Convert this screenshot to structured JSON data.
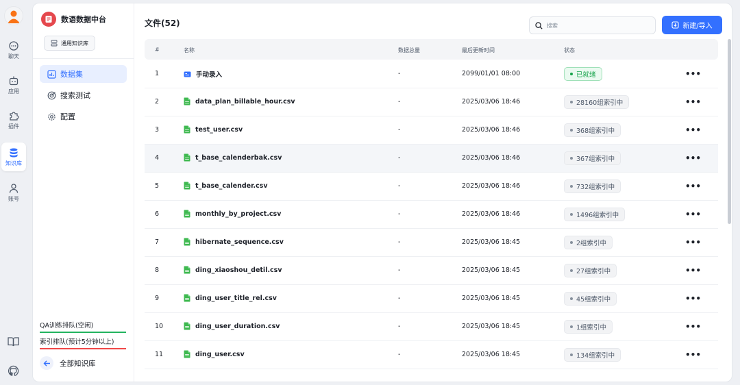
{
  "rail": {
    "items": [
      {
        "label": "聊天",
        "icon": "chat-icon"
      },
      {
        "label": "应用",
        "icon": "robot-icon"
      },
      {
        "label": "插件",
        "icon": "puzzle-icon"
      },
      {
        "label": "知识库",
        "icon": "database-icon",
        "active": true
      },
      {
        "label": "账号",
        "icon": "user-icon"
      }
    ],
    "bottom": [
      "book-icon",
      "github-icon"
    ]
  },
  "sidebar": {
    "brand": "数语数据中台",
    "kb_type": "通用知识库",
    "nav": [
      {
        "label": "数据集",
        "icon": "chart-icon",
        "active": true
      },
      {
        "label": "搜索测试",
        "icon": "target-icon"
      },
      {
        "label": "配置",
        "icon": "gear-icon"
      }
    ],
    "queue_qa": "QA训练排队(空闲)",
    "queue_index": "索引排队(预计5分钟以上)",
    "back_label": "全部知识库"
  },
  "main": {
    "title": "文件(52)",
    "search_placeholder": "搜索",
    "new_button": "新建/导入",
    "columns": {
      "index": "#",
      "name": "名称",
      "total": "数据总量",
      "updated": "最后更新时间",
      "status": "状态"
    },
    "rows": [
      {
        "index": "1",
        "name": "手动录入",
        "type": "manual",
        "total": "-",
        "time": "2099/01/01 08:00",
        "status": "已就绪",
        "ready": true
      },
      {
        "index": "2",
        "name": "data_plan_billable_hour.csv",
        "type": "csv",
        "total": "-",
        "time": "2025/03/06 18:46",
        "status": "28160组索引中"
      },
      {
        "index": "3",
        "name": "test_user.csv",
        "type": "csv",
        "total": "-",
        "time": "2025/03/06 18:46",
        "status": "368组索引中"
      },
      {
        "index": "4",
        "name": "t_base_calenderbak.csv",
        "type": "csv",
        "total": "-",
        "time": "2025/03/06 18:46",
        "status": "367组索引中",
        "hover": true
      },
      {
        "index": "5",
        "name": "t_base_calender.csv",
        "type": "csv",
        "total": "-",
        "time": "2025/03/06 18:46",
        "status": "732组索引中"
      },
      {
        "index": "6",
        "name": "monthly_by_project.csv",
        "type": "csv",
        "total": "-",
        "time": "2025/03/06 18:46",
        "status": "1496组索引中"
      },
      {
        "index": "7",
        "name": "hibernate_sequence.csv",
        "type": "csv",
        "total": "-",
        "time": "2025/03/06 18:45",
        "status": "2组索引中"
      },
      {
        "index": "8",
        "name": "ding_xiaoshou_detil.csv",
        "type": "csv",
        "total": "-",
        "time": "2025/03/06 18:45",
        "status": "27组索引中"
      },
      {
        "index": "9",
        "name": "ding_user_title_rel.csv",
        "type": "csv",
        "total": "-",
        "time": "2025/03/06 18:45",
        "status": "45组索引中"
      },
      {
        "index": "10",
        "name": "ding_user_duration.csv",
        "type": "csv",
        "total": "-",
        "time": "2025/03/06 18:45",
        "status": "1组索引中"
      },
      {
        "index": "11",
        "name": "ding_user.csv",
        "type": "csv",
        "total": "-",
        "time": "2025/03/06 18:45",
        "status": "134组索引中"
      }
    ]
  },
  "colors": {
    "accent": "#3370ff",
    "ready": "#16a34a",
    "queue_ok": "#22b35e",
    "queue_busy": "#f04848",
    "csv_icon": "#3fb950",
    "brand": "#e5484d"
  }
}
